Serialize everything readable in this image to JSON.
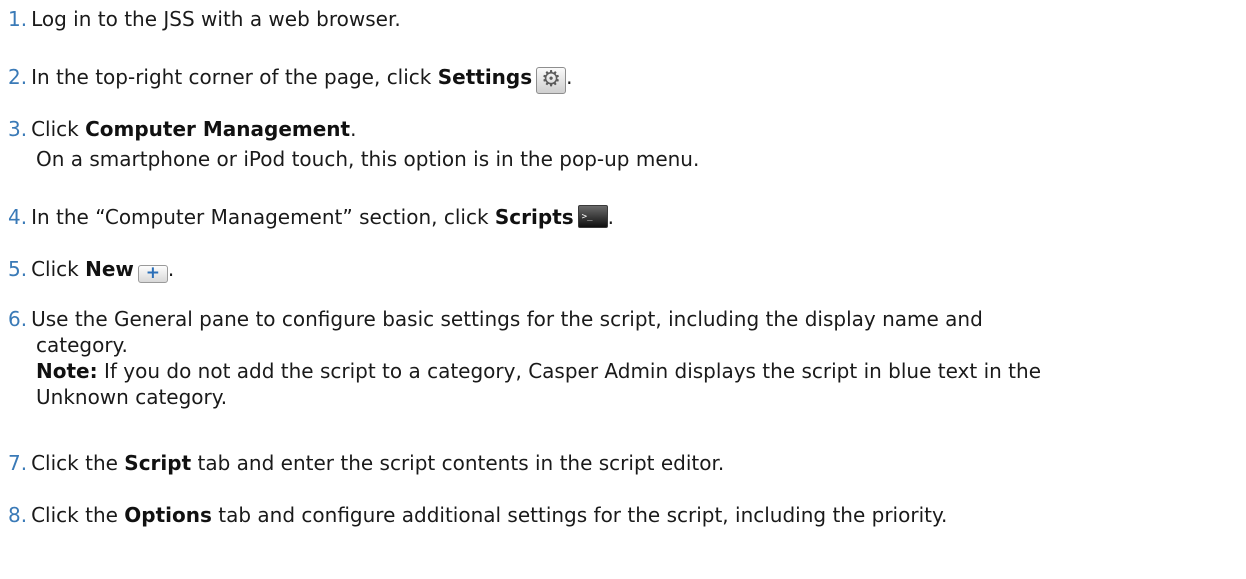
{
  "steps": [
    {
      "num": "1.",
      "text": "Log in to the JSS with a web browser."
    },
    {
      "num": "2.",
      "pre": "In the top-right corner of the page, click ",
      "bold": "Settings",
      "post": "."
    },
    {
      "num": "3.",
      "pre": "Click ",
      "bold": "Computer Management",
      "post": ".",
      "line2": "On a smartphone or iPod touch, this option is in the pop-up menu."
    },
    {
      "num": "4.",
      "pre": "In the “Computer Management” section, click ",
      "bold": "Scripts",
      "post": "."
    },
    {
      "num": "5.",
      "pre": "Click ",
      "bold": "New",
      "post": "."
    },
    {
      "num": "6.",
      "line1": "Use the General pane to configure basic settings for the script, including the display name and",
      "line2": "category.",
      "note_label": "Note:",
      "note_text": " If you do not add the script to a category, Casper Admin displays the script in blue text in the",
      "line4": "Unknown category."
    },
    {
      "num": "7.",
      "pre": "Click the ",
      "bold": "Script",
      "post": " tab and enter the script contents in the script editor."
    },
    {
      "num": "8.",
      "pre": "Click the ",
      "bold": "Options",
      "post": " tab and configure additional settings for the script, including the priority."
    }
  ],
  "icons": {
    "settings": "gear-icon",
    "scripts": "terminal-icon",
    "new": "plus-icon"
  },
  "colors": {
    "step_number": "#3a7ab7",
    "text": "#1a1a1a"
  }
}
